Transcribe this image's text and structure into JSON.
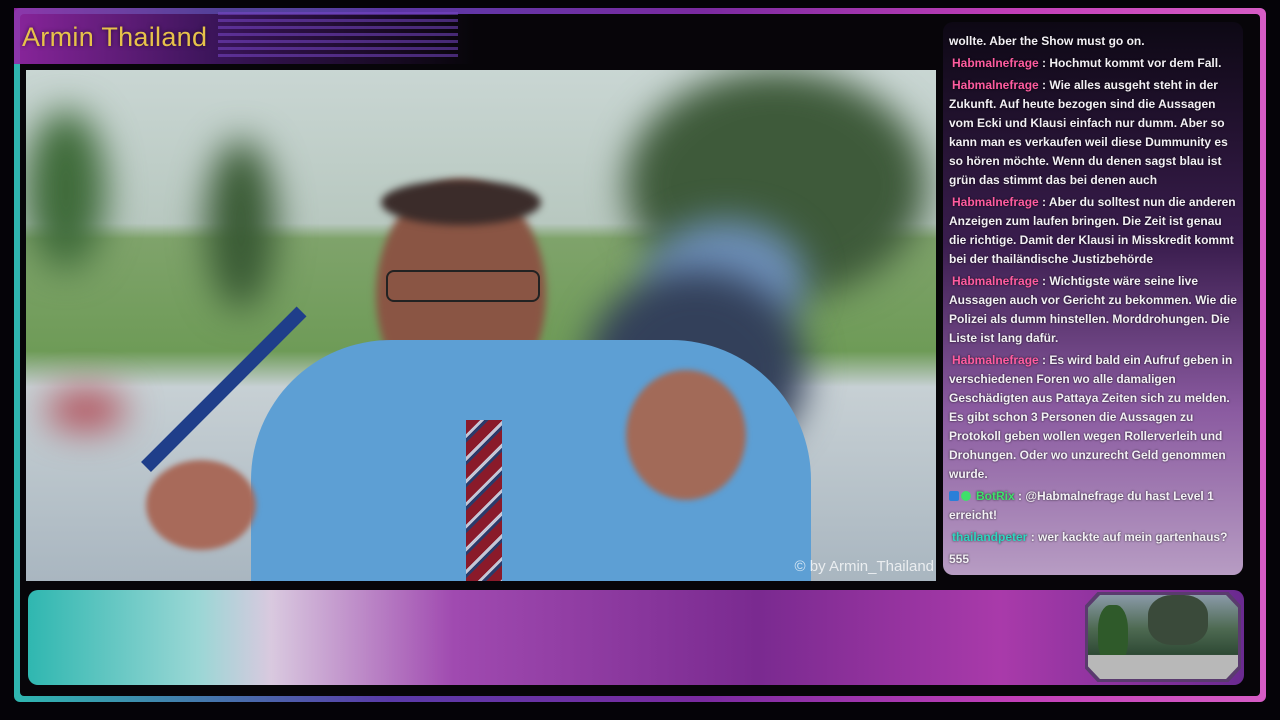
{
  "overlay": {
    "title": "Armin Thailand"
  },
  "video": {
    "watermark": "© by Armin_Thailand"
  },
  "chat": {
    "messages": [
      {
        "user": "",
        "text": "wollte. Aber the Show must go on."
      },
      {
        "user": "Habmalnefrage",
        "sep": " : ",
        "text": "Hochmut kommt vor dem Fall."
      },
      {
        "user": "Habmalnefrage",
        "sep": " : ",
        "text": "Wie alles ausgeht steht in der Zukunft. Auf heute bezogen sind die Aussagen vom Ecki und Klausi einfach nur dumm. Aber so kann man es verkaufen weil diese Dummunity es so hören möchte. Wenn du denen sagst blau ist grün das stimmt das bei denen auch"
      },
      {
        "user": "Habmalnefrage",
        "sep": " : ",
        "text": "Aber du solltest nun die anderen Anzeigen zum laufen bringen. Die Zeit ist genau die richtige. Damit der Klausi in Misskredit kommt bei der thailändische Justizbehörde"
      },
      {
        "user": "Habmalnefrage",
        "sep": " : ",
        "text": "Wichtigste wäre seine live Aussagen auch vor Gericht zu bekommen. Wie die Polizei als dumm hinstellen. Morddrohungen. Die Liste ist lang dafür."
      },
      {
        "user": "Habmalnefrage",
        "sep": " : ",
        "text": "Es wird bald ein Aufruf geben in verschiedenen Foren wo alle damaligen Geschädigten aus Pattaya Zeiten sich zu melden. Es gibt schon 3 Personen die Aussagen zu Protokoll geben wollen wegen Rollerverleih und Drohungen. Oder wo unzurecht Geld genommen wurde."
      },
      {
        "user": "BotRix",
        "sep": " : ",
        "text": "@Habmalnefrage du hast Level 1 erreicht!"
      },
      {
        "user": "thailandpeter",
        "sep": " : ",
        "text": "wer kackte auf mein gartenhaus?"
      },
      {
        "user": "",
        "text": "555"
      }
    ]
  }
}
